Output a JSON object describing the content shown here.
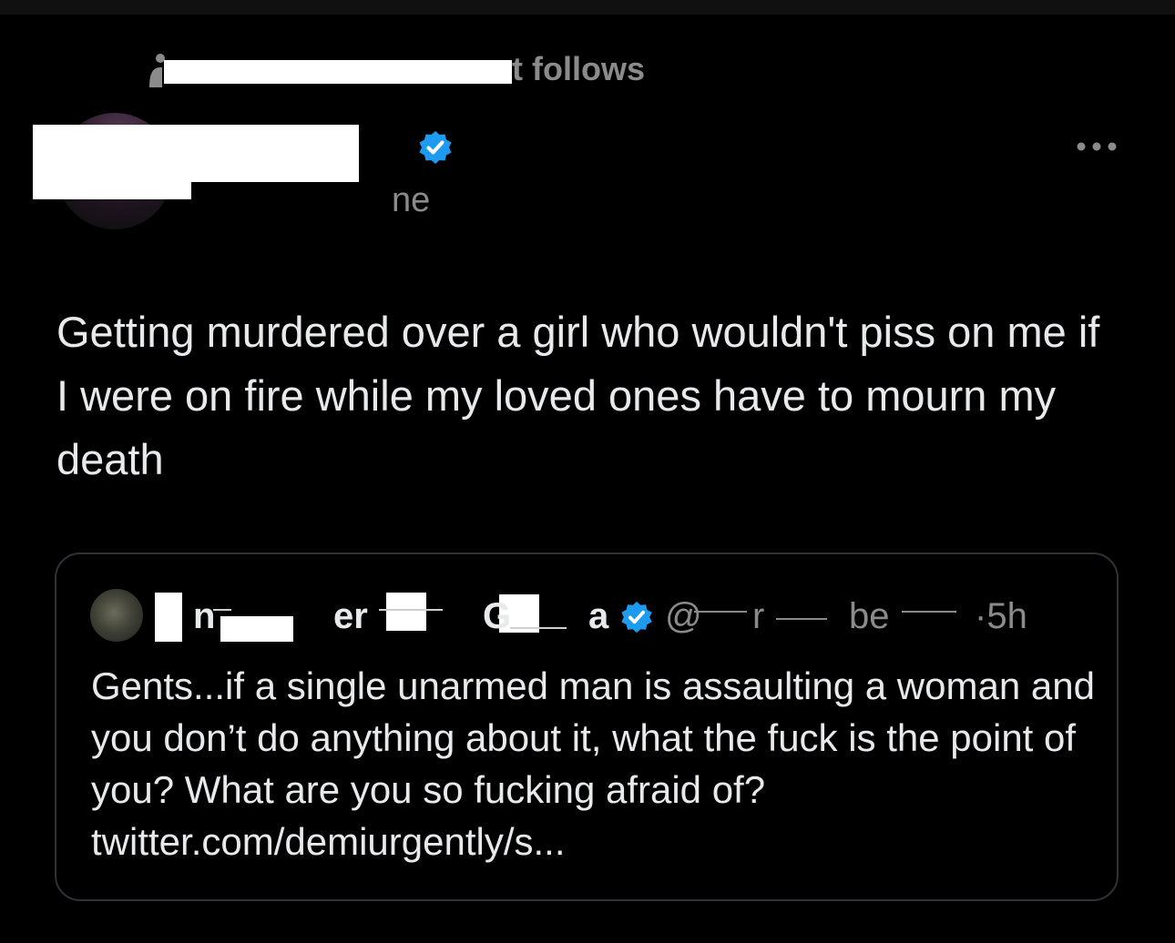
{
  "social_context": {
    "text": "t follows",
    "icon": "person-icon"
  },
  "tweet": {
    "handle_partial": "ne",
    "verified_icon": "verified-badge-icon",
    "more_icon": "more-options-icon",
    "text": "Getting murdered over a girl who wouldn't piss on me if I were on fire while my loved ones have to mourn my death"
  },
  "quoted": {
    "name_fragments": [
      "n",
      "er",
      "G",
      "a"
    ],
    "handle_fragments": [
      "@",
      "r",
      "be"
    ],
    "time": "·5h",
    "verified_icon": "verified-badge-icon",
    "text": "Gents...if a single unarmed man is assaulting a woman and you don’t do anything about it, what the fuck is the point of you? What are you so fucking afraid of? twitter.com/demiurgently/s..."
  },
  "colors": {
    "background": "#000000",
    "text": "#e7e9ea",
    "muted": "#8b8b8b",
    "verified": "#1d9bf0",
    "border": "#2f3336"
  }
}
